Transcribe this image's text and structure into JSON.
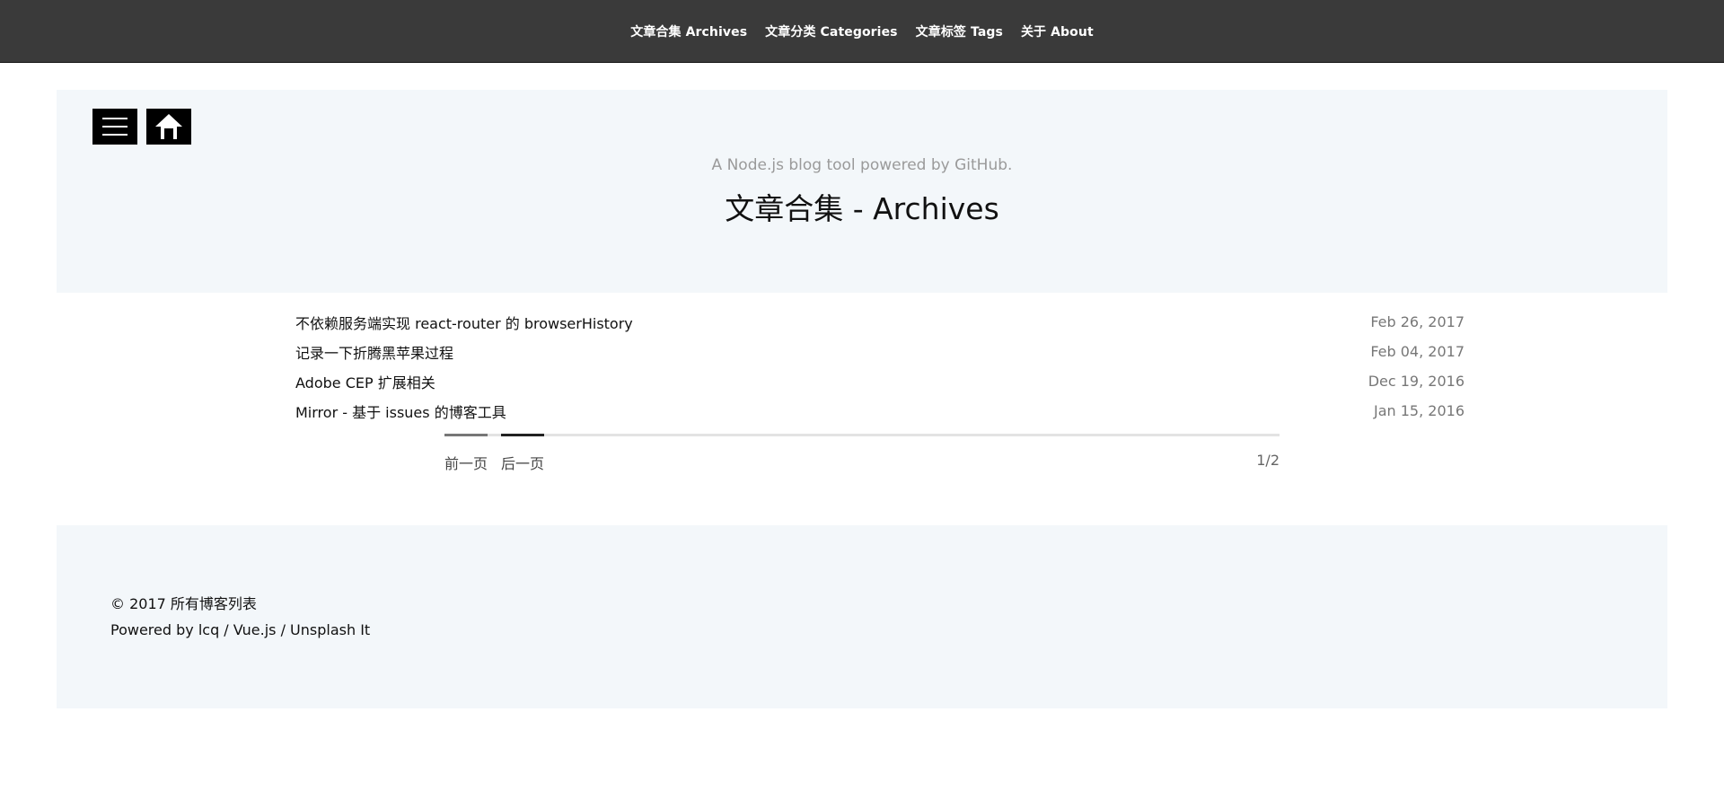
{
  "nav": {
    "items": [
      {
        "label": "文章合集 Archives"
      },
      {
        "label": "文章分类 Categories"
      },
      {
        "label": "文章标签 Tags"
      },
      {
        "label": "关于 About"
      }
    ]
  },
  "hero": {
    "subtitle": "A Node.js blog tool powered by GitHub.",
    "title": "文章合集 - Archives",
    "menu_icon": "menu-icon",
    "home_icon": "home-icon"
  },
  "posts": [
    {
      "title": "不依赖服务端实现 react-router 的 browserHistory",
      "date": "Feb 26, 2017"
    },
    {
      "title": "记录一下折腾黑苹果过程",
      "date": "Feb 04, 2017"
    },
    {
      "title": "Adobe CEP 扩展相关",
      "date": "Dec 19, 2016"
    },
    {
      "title": "Mirror - 基于 issues 的博客工具",
      "date": "Jan 15, 2016"
    }
  ],
  "pagination": {
    "prev_label": "前一页",
    "next_label": "后一页",
    "page_indicator": "1/2"
  },
  "footer": {
    "copyright": "© 2017 所有博客列表",
    "powered_by": "Powered by lcq / Vue.js / Unsplash It"
  },
  "colors": {
    "nav_bg": "#3a3a3a",
    "panel_bg": "#f3f7fa",
    "button_bg": "#000000"
  }
}
